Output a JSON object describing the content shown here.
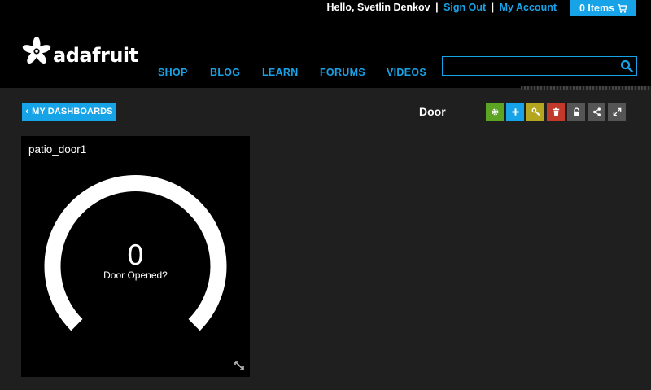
{
  "account": {
    "greeting": "Hello, Svetlin Denkov",
    "sign_out": "Sign Out",
    "my_account": "My Account",
    "separator": "|"
  },
  "cart": {
    "label": "0 Items",
    "icon": "cart-icon"
  },
  "brand": {
    "name": "adafruit",
    "logo_icon": "adafruit-flower-icon"
  },
  "nav": {
    "items": [
      {
        "label": "SHOP"
      },
      {
        "label": "BLOG"
      },
      {
        "label": "LEARN"
      },
      {
        "label": "FORUMS"
      },
      {
        "label": "VIDEOS"
      }
    ]
  },
  "search": {
    "value": "",
    "placeholder": "",
    "icon": "search-icon"
  },
  "toolbar": {
    "back_label": "MY DASHBOARDS",
    "back_chevron": "‹",
    "dashboard_title": "Door",
    "tools": [
      {
        "name": "settings",
        "icon": "gear-icon",
        "color": "#5da423"
      },
      {
        "name": "add-block",
        "icon": "plus-icon",
        "color": "#17a3e8"
      },
      {
        "name": "key",
        "icon": "key-icon",
        "color": "#b5a61f"
      },
      {
        "name": "delete",
        "icon": "trash-icon",
        "color": "#c0392b"
      },
      {
        "name": "lock",
        "icon": "lock-icon",
        "color": "#555555"
      },
      {
        "name": "share",
        "icon": "share-icon",
        "color": "#555555"
      },
      {
        "name": "fullscreen",
        "icon": "expand-icon",
        "color": "#555555"
      }
    ]
  },
  "block": {
    "title": "patio_door1",
    "value": "0",
    "label": "Door Opened?",
    "gauge_fraction": 0
  },
  "colors": {
    "accent": "#17a3e8",
    "header_bg": "#000000",
    "page_bg": "#1f1f1f"
  }
}
